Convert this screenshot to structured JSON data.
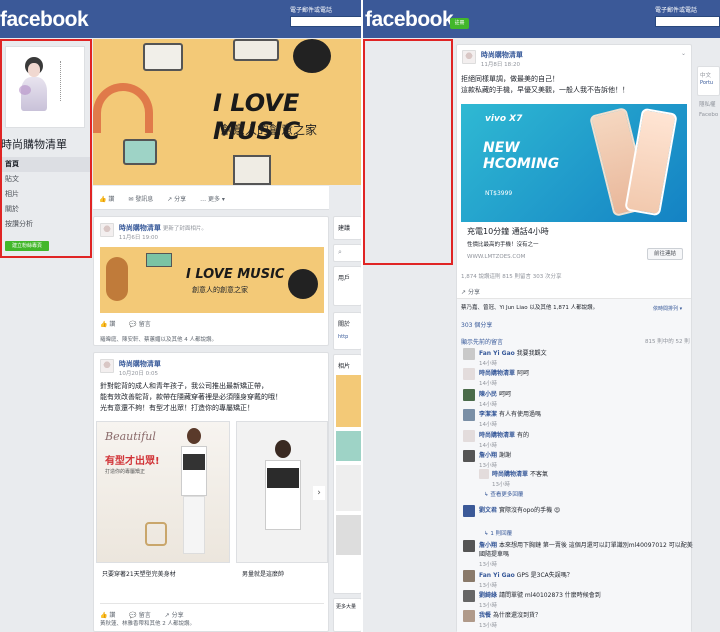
{
  "brand": {
    "logo": "facebook",
    "color": "#3b5998"
  },
  "left": {
    "topbar": {
      "login_label": "電子郵件或電話"
    },
    "page": {
      "name": "時尚購物清單",
      "nav": [
        "首頁",
        "貼文",
        "相片",
        "關於",
        "按讚分析"
      ],
      "create_page": "建立粉絲專頁"
    },
    "cover": {
      "headline": "I LOVE MUSIC",
      "subtitle": "創意人的創意之家"
    },
    "cover_actions": {
      "like": "讚",
      "message": "發訊息",
      "share": "分享",
      "more": "更多"
    },
    "post1": {
      "author": "時尚購物清單",
      "action": "更新了封面相片。",
      "time": "11月6日 19:00",
      "banner_title": "I LOVE MUSIC",
      "banner_subtitle": "創意人的創意之家",
      "actions": {
        "like": "讚",
        "comment": "留言"
      },
      "reactions": "羅暐庭、陳安軒、蔡蕙媚以及其他 4 人都說讚。"
    },
    "post2": {
      "author": "時尚購物清單",
      "time": "10月20日 0:05",
      "text": [
        "針對駝背的成人和青年孩子，我公司推出最新矯正帶，",
        "能有效改善駝背，款帶在隱藏穿著裡是必須隨身穿戴的哦！",
        "光有意還不夠！有型才出眾！打造你的專屬矯正！"
      ],
      "image1_brand": "Beautiful",
      "image1_headline": "有型才出眾!",
      "image1_sub": "打造你的專屬矯正",
      "caption1": "只要穿著21天塑型完美身材",
      "caption2": "男量就是這麼帥",
      "actions": {
        "like": "讚",
        "comment": "留言",
        "share": "分享"
      },
      "reactions": "黃秋蓮、林雅香帶和其他 2 人都說讚。"
    },
    "side": {
      "box1": "建議",
      "box2": "用戶",
      "box3": "關於",
      "box4": "相片",
      "box5": "更多大量",
      "link": "http"
    }
  },
  "right": {
    "topbar": {
      "login_label": "電子郵件或電話",
      "signup": "註冊"
    },
    "post": {
      "author": "時尚購物清單",
      "time": "11月8日 18:20",
      "text": [
        "拒絕同樣單調，做最美的自己！",
        "這款私藏的手機，早優又美觀，一般人我不告訴他！！"
      ],
      "ad_title": "充電10分鐘 通話4小時",
      "ad_desc": "性價比最高的手機！沒有之一",
      "ad_url": "WWW.LMTZOES.COM",
      "ad_button": "前往連結",
      "phone_brand": "vivo X7",
      "phone_headline": "NEW HCOMING",
      "phone_price": "NT$3999",
      "counts": "1,874 說讚這則  815 則留言  303 次分享",
      "share": "分享",
      "likers": "蔡乃嘉、曾冠、Yi Jun Liao 以及其他 1,871 人都說讚。",
      "sort": "依時間排列",
      "shares_link": "303 個分享",
      "prev_comments": "顯示先前的留言",
      "comment_count": "815 則中的 52 則"
    },
    "comments": [
      {
        "name": "Fan Yi Gao",
        "text": "我要我觀文",
        "time": "14小時"
      },
      {
        "name": "時尚購物清單",
        "text": "阿呵",
        "time": "14小時"
      },
      {
        "name": "陳小民",
        "text": "呵呵",
        "time": "14小時"
      },
      {
        "name": "李潔潔",
        "text": "有人有使用過嗎",
        "time": "14小時"
      },
      {
        "name": "時尚購物清單",
        "text": "有的",
        "time": "14小時"
      },
      {
        "name": "詹小翔",
        "text": "謝謝",
        "time": "13小時"
      },
      {
        "name": "時尚購物清單",
        "text": "不客氣",
        "time": "13小時"
      },
      {
        "name": "劉文君",
        "text": "實際沒有opo的手機",
        "time": "1 則回覆"
      },
      {
        "name": "詹小翔",
        "text": "本來想用下胸鏈 第一賣後 這個月還可以訂單識別ml40097012 可以配美國隨提車嗎",
        "time": "13小時"
      },
      {
        "name": "Fan Yi Gao",
        "text": "GPS 是3CA失誤嗎？",
        "time": "13小時"
      },
      {
        "name": "劉綺綠",
        "text": "請問單號 ml40102873 什麼時候會到",
        "time": "13小時"
      },
      {
        "name": "我餐",
        "text": "為什麼還沒到貨？",
        "time": "13小時"
      }
    ],
    "replies_link": "查看更多回覆",
    "reply_count": "1 則回覆",
    "side": {
      "line1": "中文",
      "line2": "Portu",
      "line3": "隱私權",
      "line4": "Facebo"
    }
  }
}
